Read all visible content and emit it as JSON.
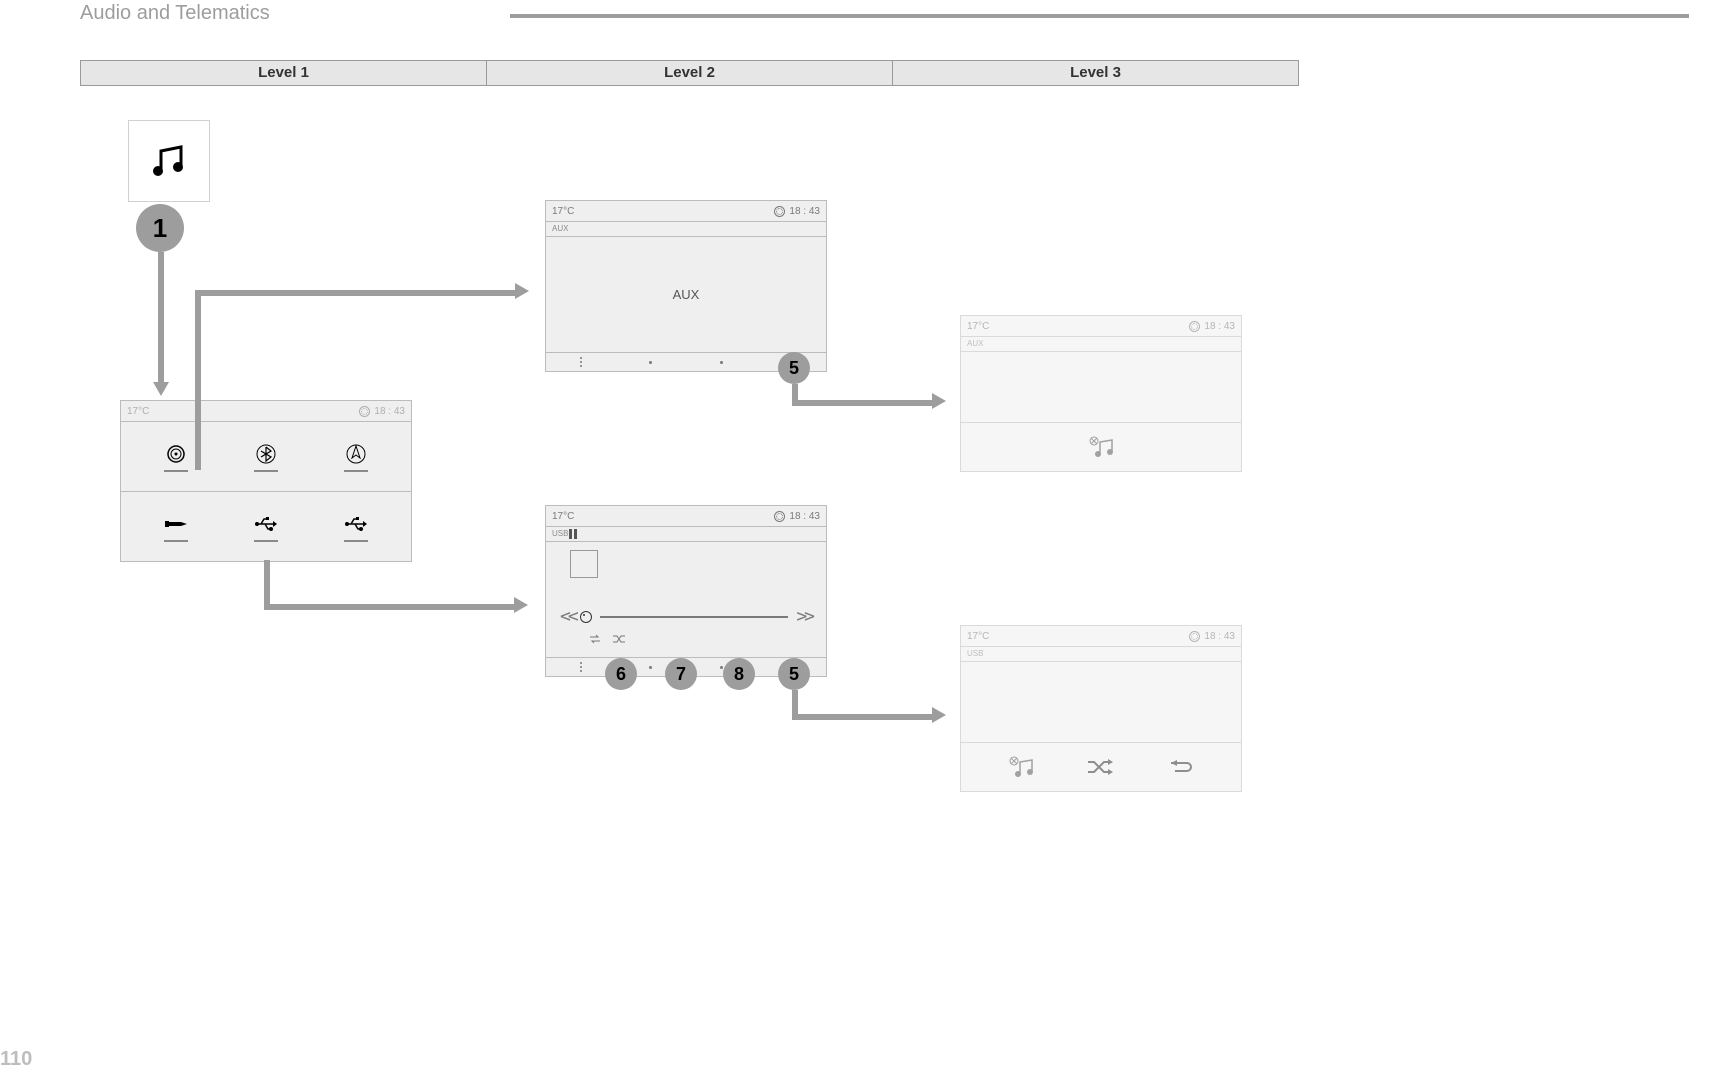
{
  "section_title": "Audio and Telematics",
  "page_number": "110",
  "levels": [
    "Level 1",
    "Level 2",
    "Level 3"
  ],
  "status": {
    "temp": "17°C",
    "time": "18 : 43"
  },
  "sources": {
    "aux_tag": "AUX",
    "usb_tag": "USB",
    "aux_center": "AUX"
  },
  "callouts": {
    "main": "1",
    "aux_menu": "5",
    "usb_a": "6",
    "usb_b": "7",
    "usb_c": "8",
    "usb_d": "5"
  }
}
